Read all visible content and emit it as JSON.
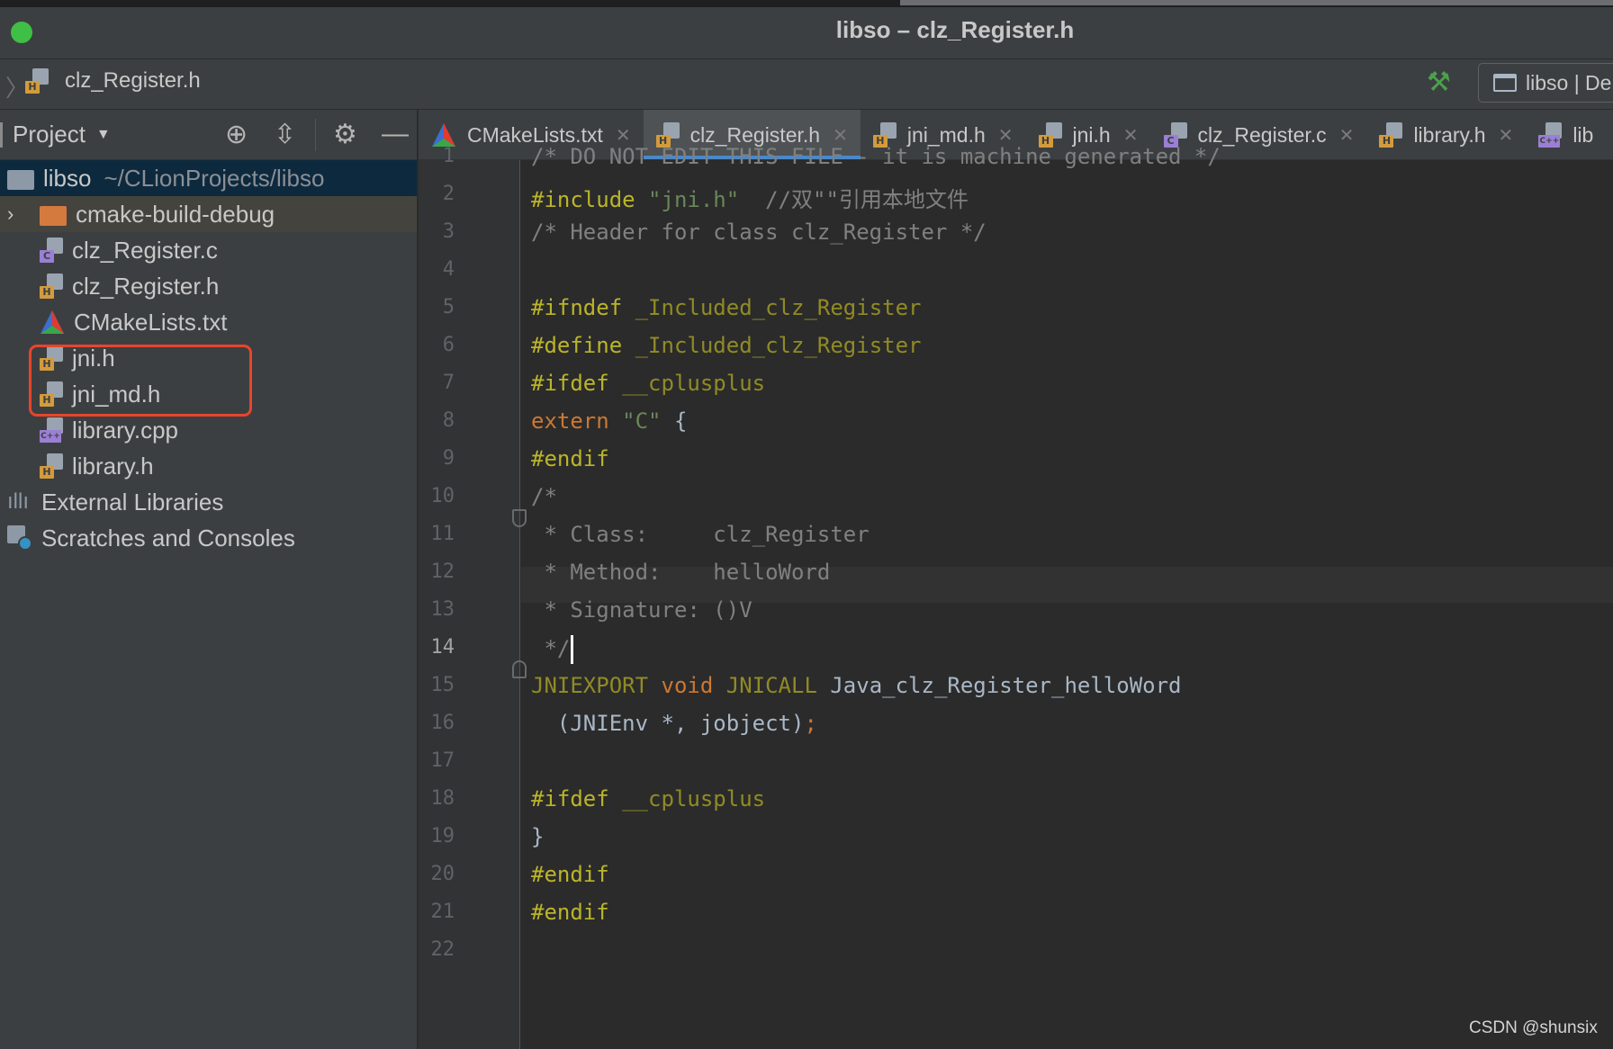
{
  "window": {
    "title": "libso – clz_Register.h"
  },
  "navbar": {
    "file_label": "clz_Register.h",
    "run_config_label": "libso | De"
  },
  "sidebar": {
    "header_label": "Project",
    "tree": [
      {
        "label": "libso",
        "detail": "~/CLionProjects/libso",
        "kind": "root"
      },
      {
        "label": "cmake-build-debug",
        "kind": "folder"
      },
      {
        "label": "clz_Register.c",
        "kind": "c"
      },
      {
        "label": "clz_Register.h",
        "kind": "h"
      },
      {
        "label": "CMakeLists.txt",
        "kind": "cmake"
      },
      {
        "label": "jni.h",
        "kind": "h"
      },
      {
        "label": "jni_md.h",
        "kind": "h"
      },
      {
        "label": "library.cpp",
        "kind": "cpp"
      },
      {
        "label": "library.h",
        "kind": "h"
      },
      {
        "label": "External Libraries",
        "kind": "lib"
      },
      {
        "label": "Scratches and Consoles",
        "kind": "scratch"
      }
    ]
  },
  "tabs": [
    {
      "label": "CMakeLists.txt",
      "kind": "cmake"
    },
    {
      "label": "clz_Register.h",
      "kind": "h",
      "active": true
    },
    {
      "label": "jni_md.h",
      "kind": "h"
    },
    {
      "label": "jni.h",
      "kind": "h"
    },
    {
      "label": "clz_Register.c",
      "kind": "c"
    },
    {
      "label": "library.h",
      "kind": "h"
    },
    {
      "label": "lib",
      "kind": "cpp"
    }
  ],
  "editor": {
    "current_line": "14",
    "line_numbers": [
      "1",
      "2",
      "3",
      "4",
      "5",
      "6",
      "7",
      "8",
      "9",
      "10",
      "11",
      "12",
      "13",
      "14",
      "15",
      "16",
      "17",
      "18",
      "19",
      "20",
      "21",
      "22"
    ],
    "lines": {
      "l1": "/* DO NOT EDIT THIS FILE - it is machine generated */",
      "l2_kw": "#include",
      "l2_str": "\"jni.h\"",
      "l2_comment": "//双\"\"引用本地文件",
      "l3": "/* Header for class clz_Register */",
      "l5_kw": "#ifndef",
      "l5_macro": "_Included_clz_Register",
      "l6_kw": "#define",
      "l6_macro": "_Included_clz_Register",
      "l7_kw": "#ifdef",
      "l7_macro": "__cplusplus",
      "l8_kw": "extern",
      "l8_str": "\"C\"",
      "l8_brace": "{",
      "l9": "#endif",
      "l10": "/*",
      "l11": " * Class:     clz_Register",
      "l12": " * Method:    helloWord",
      "l13": " * Signature: ()V",
      "l14": " */",
      "l15_macro1": "JNIEXPORT",
      "l15_kw": "void",
      "l15_macro2": "JNICALL",
      "l15_fn": "Java_clz_Register_helloWord",
      "l16_args": "  (JNIEnv *, jobject)",
      "l16_semi": ";",
      "l18_kw": "#ifdef",
      "l18_macro": "__cplusplus",
      "l19": "}",
      "l20": "#endif",
      "l21": "#endif"
    }
  },
  "watermark": "CSDN @shunsix",
  "colors": {
    "accent_tab": "#4a88c7",
    "highlight_box": "#e8452c",
    "preprocessor": "#bbb529",
    "keyword": "#cc7832",
    "string": "#6a8759",
    "comment": "#808080"
  }
}
